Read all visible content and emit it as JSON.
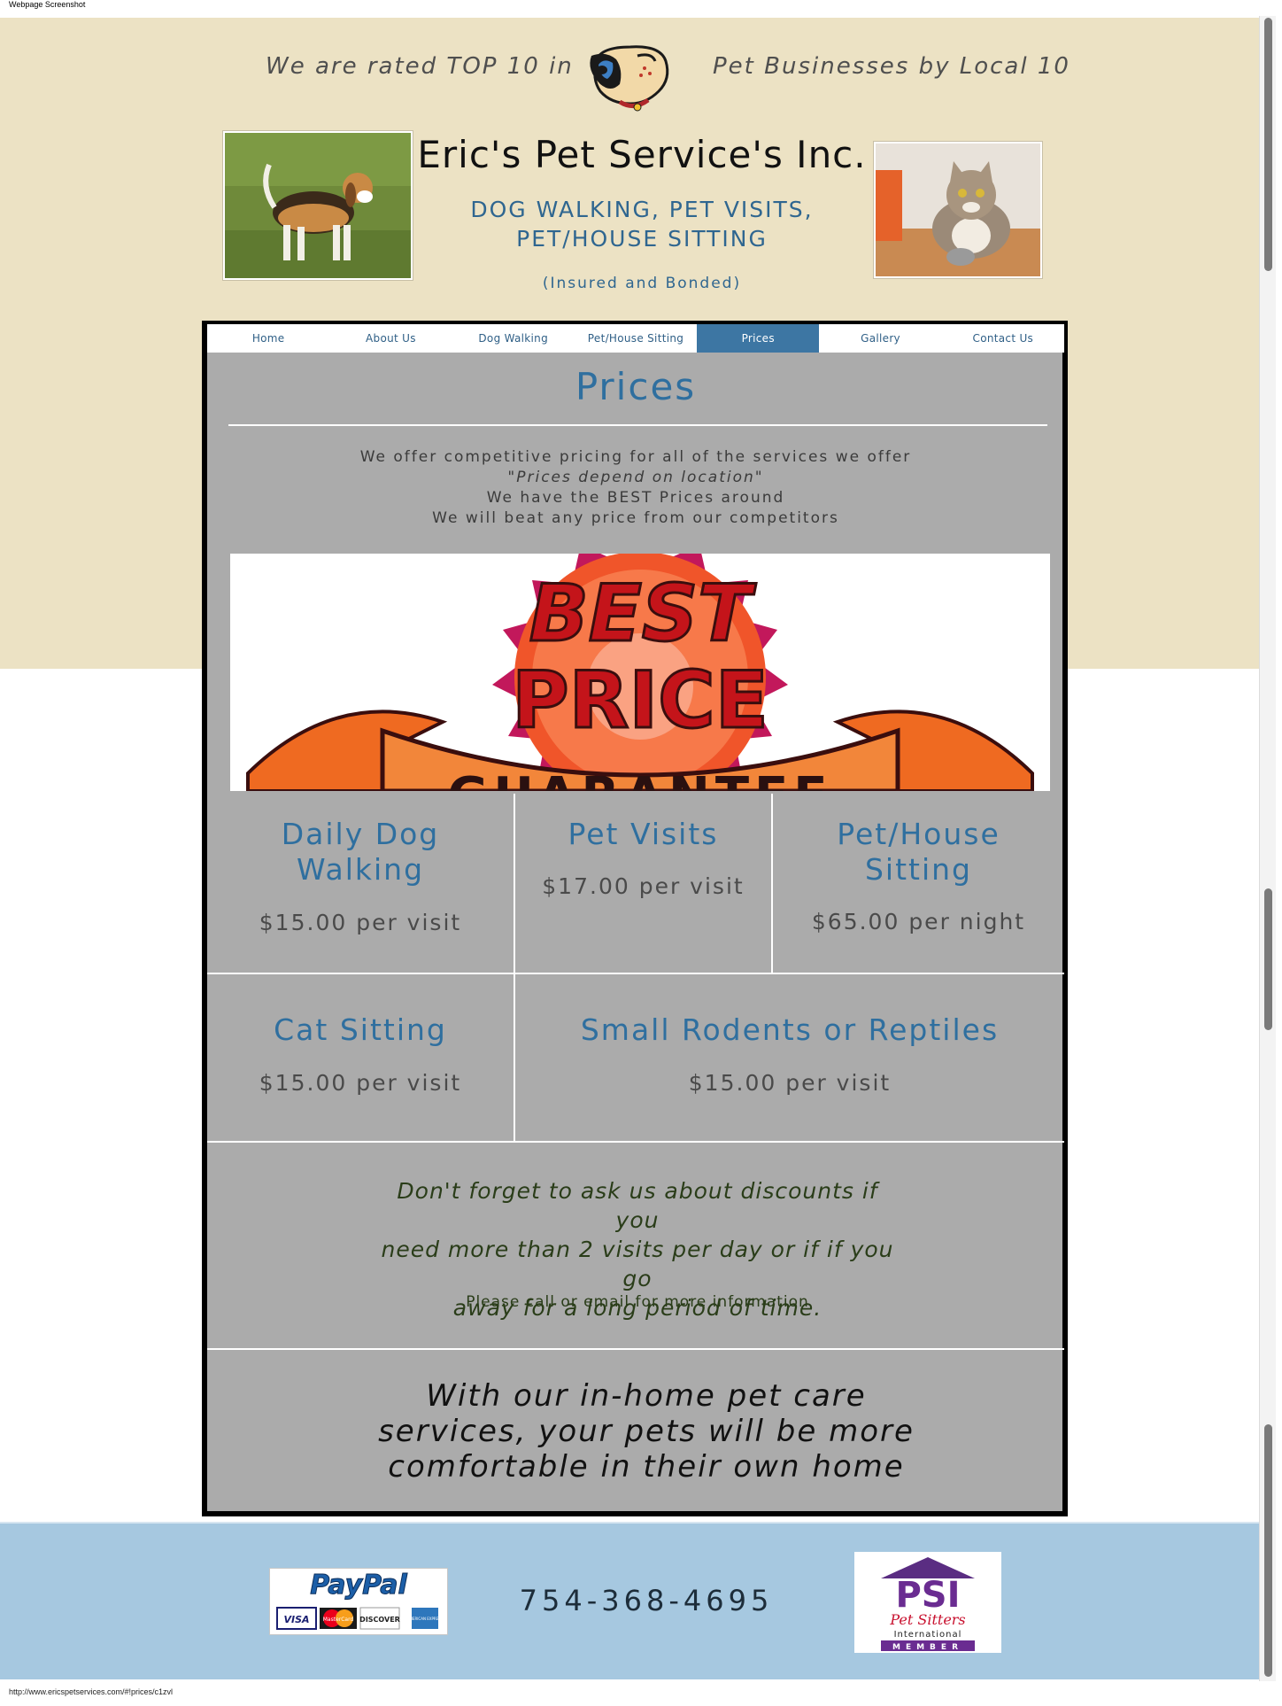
{
  "browser": {
    "caption": "Webpage Screenshot",
    "status_url": "http://www.ericspetservices.com/#!prices/c1zvl"
  },
  "header": {
    "rated_left": "We are rated TOP 10 in",
    "rated_right": "Pet Businesses by Local 10",
    "title": "Eric's Pet Service's Inc.",
    "services_line1": "DOG WALKING, PET VISITS,",
    "services_line2": "PET/HOUSE SITTING",
    "insured": "(Insured and Bonded)"
  },
  "nav": {
    "items": [
      "Home",
      "About Us",
      "Dog Walking",
      "Pet/House Sitting",
      "Prices",
      "Gallery",
      "Contact Us"
    ],
    "active": "Prices"
  },
  "prices": {
    "heading": "Prices",
    "intro": [
      "We offer competitive pricing for all of the services we offer",
      "\"Prices depend on location\"",
      "We have the BEST Prices around",
      "We will beat any price from our competitors"
    ],
    "banner": {
      "word1": "BEST",
      "word2": "PRICE",
      "word3": "GUARANTEE"
    },
    "services": [
      {
        "title": "Daily Dog Walking",
        "title_l1": "Daily Dog",
        "title_l2": "Walking",
        "price": "$15.00 per visit"
      },
      {
        "title": "Pet Visits",
        "price": "$17.00 per visit"
      },
      {
        "title": "Pet/House Sitting",
        "title_l1": "Pet/House",
        "title_l2": "Sitting",
        "price": "$65.00 per night"
      },
      {
        "title": "Cat Sitting",
        "price": "$15.00 per visit"
      },
      {
        "title": "Small Rodents or Reptiles",
        "price": "$15.00 per visit"
      }
    ],
    "discount_l1": "Don't forget to ask us about discounts if you",
    "discount_l2": "need more than 2 visits per day or if if you go",
    "discount_l3": "away for a long period of time.",
    "call_info": "Please call or email for more information",
    "inhome_l1": "With our in-home pet care",
    "inhome_l2": "services, your pets will be more",
    "inhome_l3": "comfortable in their own home"
  },
  "footer": {
    "phone": "754-368-4695",
    "paypal_logo": "PayPal",
    "cards": [
      "VISA",
      "MasterCard",
      "DISCOVER",
      "AMERICAN EXPRESS"
    ],
    "psi_logo": "PSI",
    "psi_line1": "Pet Sitters",
    "psi_line2": "International",
    "psi_line3": "MEMBER"
  },
  "colors": {
    "top_band": "#ece2c4",
    "bottom_band": "#a6c8e0",
    "panel": "#ababab",
    "accent": "#2f6f9f",
    "nav_active": "#3d76a3"
  }
}
